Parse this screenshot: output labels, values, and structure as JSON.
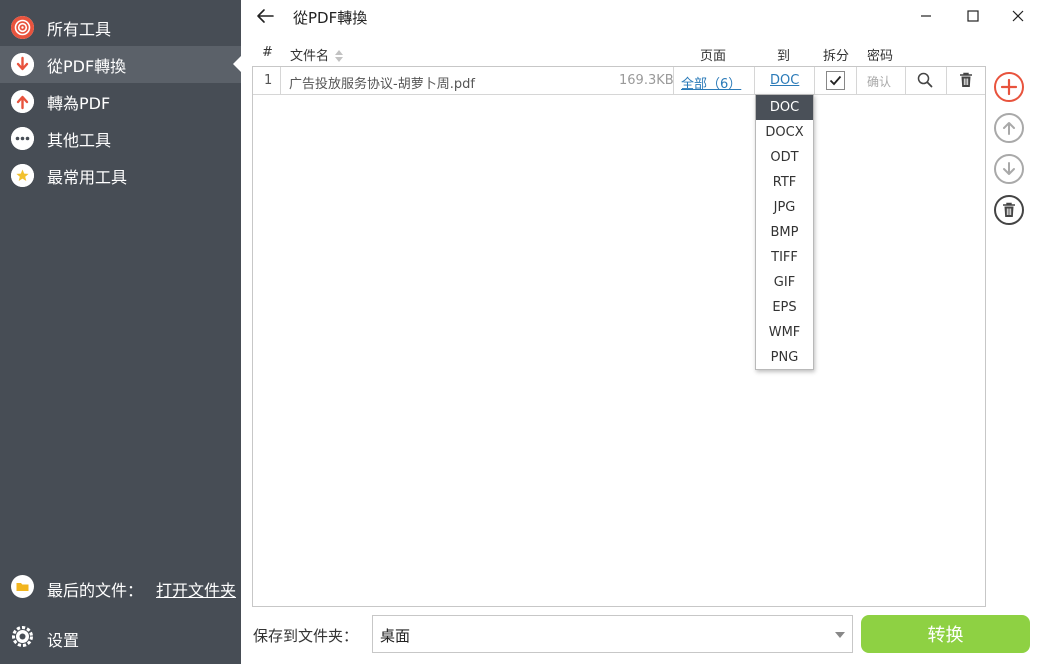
{
  "sidebar": {
    "items": [
      {
        "label": "所有工具",
        "icon": "spiral-icon"
      },
      {
        "label": "從PDF轉換",
        "icon": "arrow-down-icon"
      },
      {
        "label": "轉為PDF",
        "icon": "arrow-up-icon"
      },
      {
        "label": "其他工具",
        "icon": "more-dots-icon"
      },
      {
        "label": "最常用工具",
        "icon": "star-icon"
      }
    ],
    "recent_label": "最后的文件：",
    "open_folder_link": "打开文件夹",
    "settings_label": "设置"
  },
  "titlebar": {
    "title": "從PDF轉換"
  },
  "table": {
    "headers": {
      "index": "#",
      "filename": "文件名",
      "pages": "页面",
      "to": "到",
      "split": "拆分",
      "password": "密码"
    },
    "rows": [
      {
        "index": "1",
        "filename": "广告投放服务协议-胡萝卜周.pdf",
        "size": "169.3KB",
        "pages": "全部（6）",
        "format": "DOC",
        "split_checked": true,
        "password": "确认"
      }
    ]
  },
  "format_dropdown": {
    "selected": "DOC",
    "options": [
      "DOC",
      "DOCX",
      "ODT",
      "RTF",
      "JPG",
      "BMP",
      "TIFF",
      "GIF",
      "EPS",
      "WMF",
      "PNG"
    ]
  },
  "bottom": {
    "save_to_label": "保存到文件夹：",
    "folder_value": "桌面",
    "convert_label": "转换"
  },
  "colors": {
    "sidebar_bg": "#474d55",
    "accent_red": "#e8533d",
    "convert_green": "#8ed143",
    "link_blue": "#2a7ab8"
  }
}
